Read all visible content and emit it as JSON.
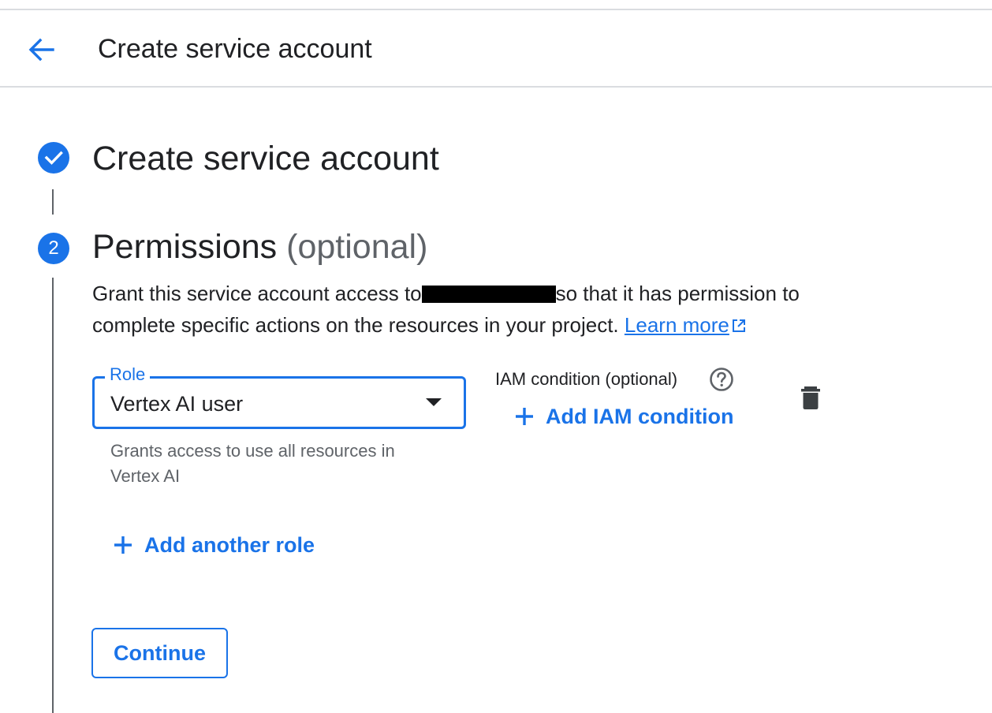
{
  "header": {
    "title": "Create service account",
    "back_icon": "arrow-back-icon"
  },
  "steps": [
    {
      "status": "completed",
      "icon": "check-icon",
      "title": "Create service account"
    },
    {
      "status": "active",
      "number": "2",
      "title": "Permissions",
      "title_suffix": "(optional)"
    }
  ],
  "permissions": {
    "description_before": "Grant this service account access to",
    "description_after": "so that it has permission to complete specific actions on the resources in your project.",
    "learn_more": "Learn more",
    "role": {
      "label": "Role",
      "value": "Vertex AI user",
      "helper": "Grants access to use all resources in Vertex AI"
    },
    "iam_condition": {
      "label": "IAM condition (optional)",
      "add_label": "Add IAM condition"
    },
    "add_role_label": "Add another role",
    "continue_label": "Continue"
  },
  "colors": {
    "accent": "#1a73e8",
    "text": "#202124",
    "secondary_text": "#5f6368",
    "divider": "#dadce0"
  }
}
